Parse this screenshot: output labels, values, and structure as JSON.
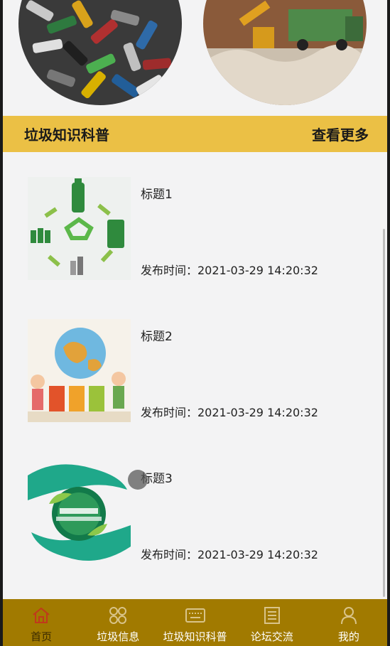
{
  "banner": {
    "images": [
      "batteries-photo",
      "construction-waste-photo"
    ]
  },
  "section": {
    "title": "垃圾知识科普",
    "more_label": "查看更多"
  },
  "articles": [
    {
      "title": "标题1",
      "time": "发布时间：2021-03-29 14:20:32",
      "image": "recycling-bottles-image"
    },
    {
      "title": "标题2",
      "time": "发布时间：2021-03-29 14:20:32",
      "image": "kids-earth-sorting-image"
    },
    {
      "title": "标题3",
      "time": "发布时间：2021-03-29 14:20:32",
      "image": "save-the-world-image"
    }
  ],
  "tabbar": {
    "items": [
      {
        "label": "首页",
        "icon": "home-icon",
        "active": true
      },
      {
        "label": "垃圾信息",
        "icon": "grid-icon",
        "active": false
      },
      {
        "label": "垃圾知识科普",
        "icon": "keyboard-icon",
        "active": false
      },
      {
        "label": "论坛交流",
        "icon": "forum-icon",
        "active": false
      },
      {
        "label": "我的",
        "icon": "user-icon",
        "active": false
      }
    ]
  },
  "colors": {
    "accent": "#ebc045",
    "tabbar": "#a17a00",
    "active_tab": "#c0391b"
  }
}
